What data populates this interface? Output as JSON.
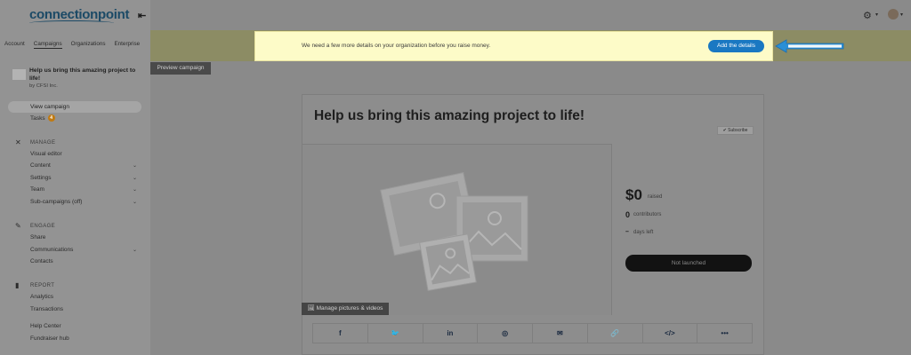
{
  "brand": {
    "logo_text": "connectionpoint"
  },
  "topnav": [
    "Account",
    "Campaigns",
    "Organizations",
    "Enterprise"
  ],
  "campaign": {
    "title": "Help us bring this amazing project to life!",
    "org": "by CFSI Inc."
  },
  "sidebar": {
    "view_campaign": "View campaign",
    "tasks": "Tasks",
    "tasks_count": "4",
    "manage_heading": "MANAGE",
    "visual_editor": "Visual editor",
    "content": "Content",
    "settings": "Settings",
    "team": "Team",
    "sub_campaigns": "Sub-campaigns (off)",
    "engage_heading": "ENGAGE",
    "share": "Share",
    "communications": "Communications",
    "contacts": "Contacts",
    "report_heading": "REPORT",
    "analytics": "Analytics",
    "transactions": "Transactions",
    "help_center": "Help Center",
    "fundraiser_hub": "Fundraiser hub"
  },
  "banner": {
    "message": "We need a few more details on your organization before you raise money.",
    "button": "Add the details"
  },
  "preview_button": "Preview campaign",
  "card": {
    "title": "Help us bring this amazing project to life!",
    "subscribe": "✔ Subscribe",
    "raised_amount": "$0",
    "raised_label": "raised",
    "contributors_count": "0",
    "contributors_label": "contributors",
    "days_value": "–",
    "days_label": "days left",
    "launch_button": "Not launched",
    "manage_media": "🖼 Manage pictures & videos"
  },
  "share_icons": [
    "facebook-icon",
    "twitter-icon",
    "linkedin-icon",
    "messenger-icon",
    "email-icon",
    "link-icon",
    "embed-icon",
    "more-icon"
  ],
  "colors": {
    "banner_bg": "#fdfbc8",
    "primary_button": "#1a78c2",
    "arrow": "#2a8fd6",
    "task_badge": "#c07a12"
  }
}
